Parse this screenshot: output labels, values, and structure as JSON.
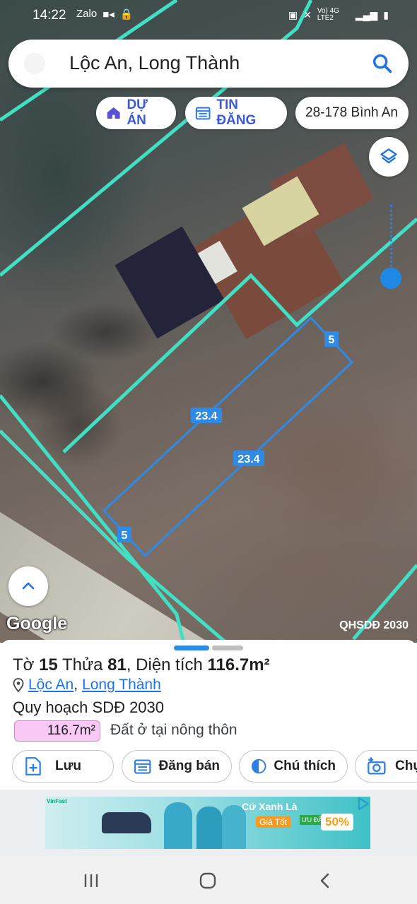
{
  "status_bar": {
    "time": "14:22",
    "left_icons": [
      "zalo-icon",
      "video-camera-icon",
      "lock-icon"
    ],
    "signal_text": "Vo) 4G LTE2"
  },
  "search": {
    "query": "Lộc An, Long Thành"
  },
  "chips": {
    "du_an": "DỰ ÁN",
    "tin_dang": "TIN ĐĂNG",
    "location": "28-178 Bình An"
  },
  "map": {
    "edge_labels": [
      "5",
      "23.4",
      "23.4",
      "5"
    ],
    "attribution": "Google",
    "layer_name": "QHSDĐ 2030",
    "boundary_color": "#41e0c4",
    "parcel_color": "#2f8ae6"
  },
  "sheet": {
    "parcel_prefix": "Tờ ",
    "sheet_no": "15",
    "parcel_mid": " Thửa ",
    "parcel_no": "81",
    "area_prefix": ", Diện tích ",
    "area_value": "116.7m²",
    "commune": "Lộc An",
    "separator": ",",
    "district": "Long Thành",
    "plan_title": "Quy hoạch SDĐ 2030",
    "plan_area": "116.7m²",
    "plan_type": "Đất ở tại nông thôn",
    "actions": [
      "Lưu",
      "Đăng bán",
      "Chú thích",
      "Chụp"
    ]
  },
  "ad": {
    "brand": "VinFast",
    "title": "Cứ Xanh Là",
    "subtitle": "Giá Tốt",
    "badge": "ƯU ĐÃI",
    "percent": "50%"
  }
}
